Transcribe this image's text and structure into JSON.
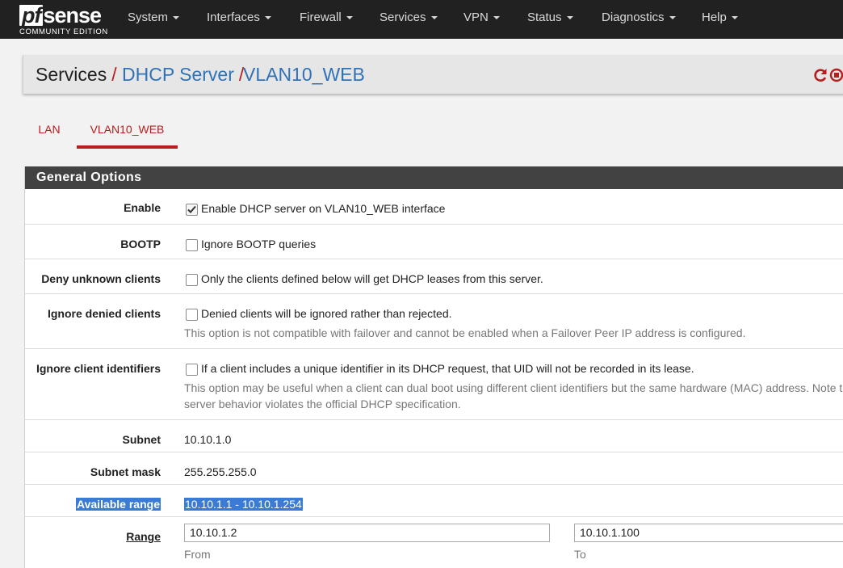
{
  "brand": {
    "logo_pf": "pf",
    "logo_sense": "sense",
    "edition": "COMMUNITY EDITION"
  },
  "nav": {
    "items": [
      {
        "label": "System"
      },
      {
        "label": "Interfaces"
      },
      {
        "label": "Firewall"
      },
      {
        "label": "Services"
      },
      {
        "label": "VPN"
      },
      {
        "label": "Status"
      },
      {
        "label": "Diagnostics"
      },
      {
        "label": "Help"
      }
    ]
  },
  "breadcrumb": {
    "items": [
      "Services",
      "DHCP Server",
      "VLAN10_WEB"
    ],
    "separator": "/",
    "icons": [
      "reload-icon",
      "stop-icon"
    ]
  },
  "tabs": [
    {
      "label": "LAN",
      "active": false
    },
    {
      "label": "VLAN10_WEB",
      "active": true
    }
  ],
  "panel": {
    "title": "General Options",
    "rows": {
      "enable": {
        "label": "Enable",
        "checked": true,
        "text": "Enable DHCP server on VLAN10_WEB interface"
      },
      "bootp": {
        "label": "BOOTP",
        "checked": false,
        "text": "Ignore BOOTP queries"
      },
      "deny_unknown": {
        "label": "Deny unknown clients",
        "checked": false,
        "text": "Only the clients defined below will get DHCP leases from this server."
      },
      "ignore_denied": {
        "label": "Ignore denied clients",
        "checked": false,
        "text": "Denied clients will be ignored rather than rejected.",
        "help": "This option is not compatible with failover and cannot be enabled when a Failover Peer IP address is configured."
      },
      "ignore_client_ids": {
        "label": "Ignore client identifiers",
        "checked": false,
        "text": "If a client includes a unique identifier in its DHCP request, that UID will not be recorded in its lease.",
        "help_line1": "This option may be useful when a client can dual boot using different client identifiers but the same hardware (MAC) address. Note t",
        "help_line2": "server behavior violates the official DHCP specification."
      },
      "subnet": {
        "label": "Subnet",
        "value": "10.10.1.0"
      },
      "subnet_mask": {
        "label": "Subnet mask",
        "value": "255.255.255.0"
      },
      "available_range": {
        "label": "Available range",
        "value": "10.10.1.1 - 10.10.1.254"
      },
      "range": {
        "label": "Range",
        "from_value": "10.10.1.2",
        "from_label": "From",
        "to_value": "10.10.1.100",
        "to_label": "To"
      }
    }
  },
  "colors": {
    "navbar": "#212121",
    "accent_red": "#b81d1b",
    "link_blue": "#2f72b5",
    "panel_heading": "#424242",
    "selection": "#3a7bd5"
  }
}
